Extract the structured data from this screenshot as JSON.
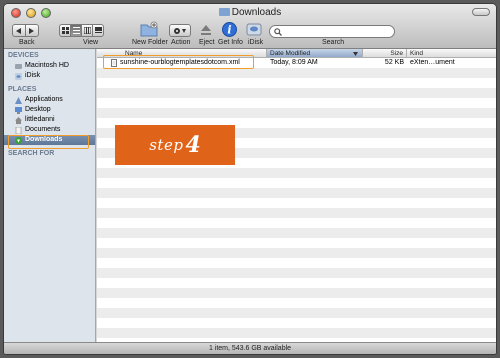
{
  "window": {
    "title": "Downloads"
  },
  "toolbar": {
    "back_label": "Back",
    "view_label": "View",
    "new_folder_label": "New Folder",
    "action_label": "Action",
    "eject_label": "Eject",
    "get_info_label": "Get Info",
    "idisk_label": "iDisk",
    "search_label": "Search",
    "search_value": ""
  },
  "sidebar": {
    "devices_header": "DEVICES",
    "devices": [
      {
        "label": "Macintosh HD",
        "icon": "hard-drive-icon"
      },
      {
        "label": "iDisk",
        "icon": "idisk-icon"
      }
    ],
    "places_header": "PLACES",
    "places": [
      {
        "label": "Applications",
        "icon": "applications-icon"
      },
      {
        "label": "Desktop",
        "icon": "desktop-icon"
      },
      {
        "label": "littledanni",
        "icon": "home-icon"
      },
      {
        "label": "Documents",
        "icon": "documents-icon"
      },
      {
        "label": "Downloads",
        "icon": "downloads-icon",
        "selected": true
      }
    ],
    "search_header": "SEARCH FOR"
  },
  "list": {
    "columns": [
      "Name",
      "Date Modified",
      "Size",
      "Kind"
    ],
    "sorted_column": "Date Modified",
    "rows": [
      {
        "name": "sunshine-ourblogtemplatesdotcom.xml",
        "date": "Today, 8:09 AM",
        "size": "52 KB",
        "kind": "eXten…ument"
      }
    ]
  },
  "overlay": {
    "step_word": "step",
    "step_number": "4"
  },
  "status": {
    "text": "1 item, 543.6 GB available"
  },
  "colors": {
    "accent_orange": "#e0631a",
    "highlight": "#f29d2a",
    "selection": "#5f7898"
  }
}
